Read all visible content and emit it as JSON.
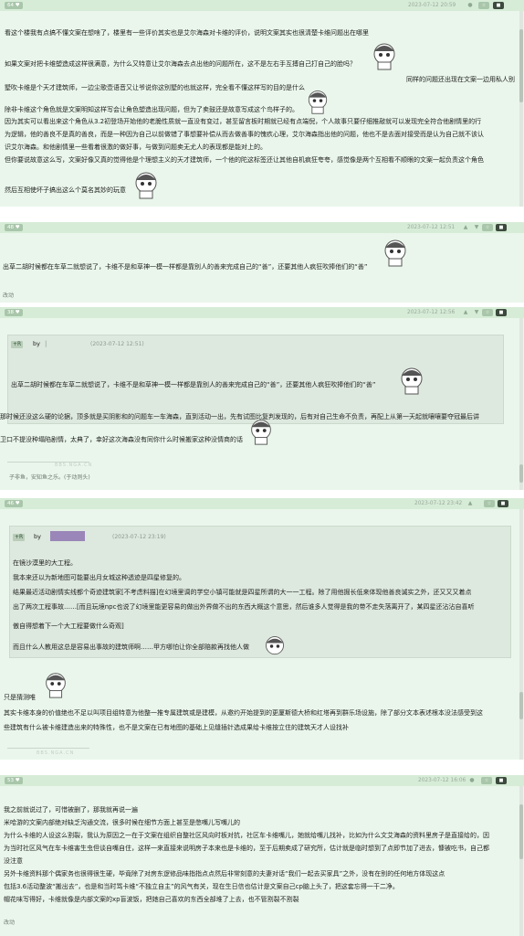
{
  "posts": [
    {
      "floor": "64 ♥",
      "date": "2023-07-12 20:59",
      "lines": [
        "看这个楼我有点搞不懂文案在想啥了，楼里有一些评价其实也是艾尔海森对卡维的评价，说明文案其实也很清楚卡维问题出在哪里",
        "如果文案对把卡维塑造成这样很满意，为什么又特意让艾尔海森去点出他的问题所在，这不是左右手互搏自己打自己的脸吗？",
        "同样的问题还出现在文案一边用私人别墅吹卡维是个天才建筑师，一边尘歌壶语音又让爷说你这别墅的也就这样，完全看不懂这样写的目的是什么",
        "除非卡维这个角色就是文案明知这样写会让角色塑造出现问题，但为了卖鼓还是故意写成这个鸟样子的。",
        "因为其实可以看出来这个角色从3.2初登场开始他的老脆性质就一直没有变过，甚至留言板时期就已经有点端倪，个人故事只要仔细推敲就可以发现完全符合他剧情里的行",
        "为逻辑，他的善良不是真的善良，而是一种因为自己以前做错了事想要补偿从而去做善事的愧疚心理，艾尔海森指出他的问题，他也不是去面对接受而是认为自己就不该认",
        "识艾尔海森。和他剧情里一些看着很激的做好事，与做到问题卖无尤人的表现都是能对上的。",
        "但你要说故意这么写，文案好像又真的觉得他是个理想主义的天才建筑师，一个他的陀这标签还让其他自机疯狂夸夸，感觉像是两个互相看不顺眼的文案一起负责这个角色",
        "然后互相使坏子搞出这么个莫名其妙的玩意"
      ]
    },
    {
      "floor": "48 ♥",
      "date": "2023-07-12 12:51",
      "lines": [
        "出草二胡时候都在车草二就想说了，卡维不是和草神一模一样都是靠别人的善来完成自己的“善”，还要其他人疯狂吹捧他们的“善”"
      ],
      "sig": "改动"
    },
    {
      "floor": "38 ♥",
      "date": "2023-07-12 12:56",
      "quote": {
        "tag": "+R",
        "by": "by",
        "date": "(2023-07-12 12:51)",
        "text": "出草二胡时候都在车草二就想说了，卡维不是和草神一模一样都是靠别人的善来完成自己的“善”，还要其他人疯狂吹捧他们的“善”"
      },
      "lines": [
        "那时候还没这么硬的论据，顶多就是买阴影和的问题车一车海森，直到活动一出，先有试图比复判发现的，后有对自己生命不负责，再配上从第一天起就嚷嚷要夺冠最后讲",
        "卫口不提没种塌陷剧情，太典了，幸好这次海森没有同你什么时候搬家这种没情商的话"
      ],
      "sig": "子非鱼，安知鱼之乐。(于动则头)",
      "wm": "BBS.NGA.CN"
    },
    {
      "floor": "46 ♥",
      "date": "2023-07-12 23:42",
      "quote": {
        "tag": "+R",
        "by": "by",
        "date": "(2023-07-12 23:19)",
        "lines": [
          "在镜沙漠里的大工程。",
          "我本来还以为新地图可能要出月女城这种透迹是四星修复的。",
          "结果最近活动剧情实线都个奇迹建筑家[不考虑料描]在幻境里调的学空小镇可能就是四星所谓的大一一工程。除了用他掘长低来体现他善良诚实之外，还又又又着点",
          "出了两次工程事故……[而且玩境npc也说了幻境里能更容易的做出外界做不出的东西大概这个意思，然后谁多人觉得是我的带不走失落离开了，某四星还沾沾自喜听",
          "傲自得想着下一个大工程要做什么奇观]",
          "而且什么人教用这总是容易出事故的建筑师啊……甲方哪怕让你全部赔款再找他人做"
        ]
      },
      "lines": [
        "只是猜测唯",
        "其实卡维本身的价值绝也不足以叫项目组特意为他整一推专属建筑或是建模，从邀约开始提到的更厦斯德大桥和红塔再到群乐场设施，除了部分文本表述根本没法感受到这",
        "些建筑有什么被卡维建造出来的特殊性，也不是文案在已有地图的基础上见缝插针选成果给卡维按立住的建筑天才人设找补"
      ],
      "wm": "BBS.NGA.CN"
    },
    {
      "floor": "53 ♥",
      "date": "2023-07-12 16:06",
      "lines": [
        "我之前就说过了，可惜被删了，那我就再说一遍",
        "米哈游的文案内部绝对缺乏沟通交流，很多时候在细节方面上甚至是憋嘴儿写嘴儿的",
        "为什么卡维的人设这么割裂，我认为原因之一在于文案在组织自整社区风向时板对抗，社区车卡维嘴儿，她就给嘴儿找补，比如为什么文艾海森的资料里房子是直接给的，因",
        "为当时社区风气在车卡维害生虫但谈自嘴自住，这样一来直接来说明房子本来也是卡维的，至于后期卖成了研究所，估计就是临时想到了点即节加了进去，慷被吃书，自己都",
        "没注意",
        "另外卡维资料那个偶家务也很得很生硬，毕竟除了对房东逻修品味指指点点然后非常刻意的夫妻对话“我们一起去买家具”之外，没有在别的任何地方体现这点",
        "包括3.6活动整波“搬出去”，也是和当时骂卡维“不独立自主”的风气有关，现在生日信也估计是文案自己cp脑上头了，把这套忘得一干二净。",
        "帽花味写得好，卡维就像是内部文案的xp盲波饭，把她自己喜欢的东西全部堆了上去，也不管割裂不割裂"
      ],
      "sig": "改动"
    }
  ],
  "header_icons": {
    "star": "☆",
    "book_icon": "bookmark-icon",
    "reply_icon": "reply-icon"
  },
  "colors": {
    "post_bg": "#eaf6eb",
    "head_bg": "#d6ecd7",
    "quote_bg": "#dde8de",
    "accent": "#a9c6aa"
  }
}
